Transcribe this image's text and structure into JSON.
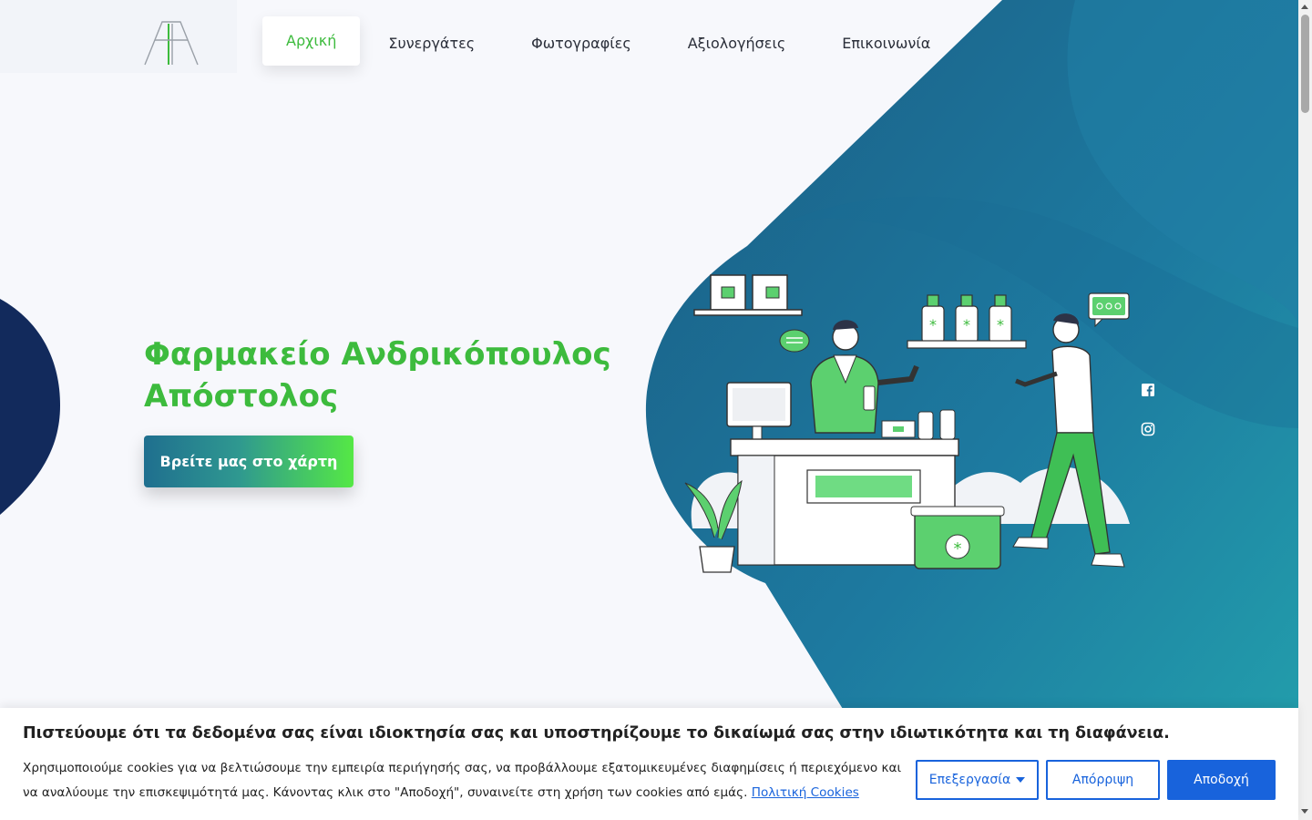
{
  "nav": {
    "items": [
      {
        "label": "Αρχική",
        "active": true
      },
      {
        "label": "Συνεργάτες"
      },
      {
        "label": "Φωτογραφίες"
      },
      {
        "label": "Αξιολογήσεις"
      },
      {
        "label": "Επικοινωνία"
      }
    ]
  },
  "hero": {
    "title_line1": "Φαρμακείο Ανδρικόπουλος",
    "title_line2": "Απόστολος",
    "cta_label": "Βρείτε μας στο χάρτη"
  },
  "social": {
    "icons": [
      "facebook-icon",
      "instagram-icon"
    ]
  },
  "cookie": {
    "title": "Πιστεύουμε ότι τα δεδομένα σας είναι ιδιοκτησία σας και υποστηρίζουμε το δικαίωμά σας στην ιδιωτικότητα και τη διαφάνεια.",
    "text": "Χρησιμοποιούμε cookies για να βελτιώσουμε την εμπειρία περιήγησής σας, να προβάλλουμε εξατομικευμένες διαφημίσεις ή περιεχόμενο και να αναλύουμε την επισκεψιμότητά μας. Κάνοντας κλικ στο \"Αποδοχή\", συναινείτε στη χρήση των cookies από εμάς.",
    "policy_link": "Πολιτική Cookies",
    "customize_label": "Επεξεργασία",
    "reject_label": "Απόρριψη",
    "accept_label": "Αποδοχή"
  },
  "colors": {
    "brand_green": "#3dbb3d",
    "teal_dark": "#1b5a7e",
    "teal_light": "#2596a8",
    "navy": "#122a5c",
    "cookie_blue": "#1863dc"
  }
}
